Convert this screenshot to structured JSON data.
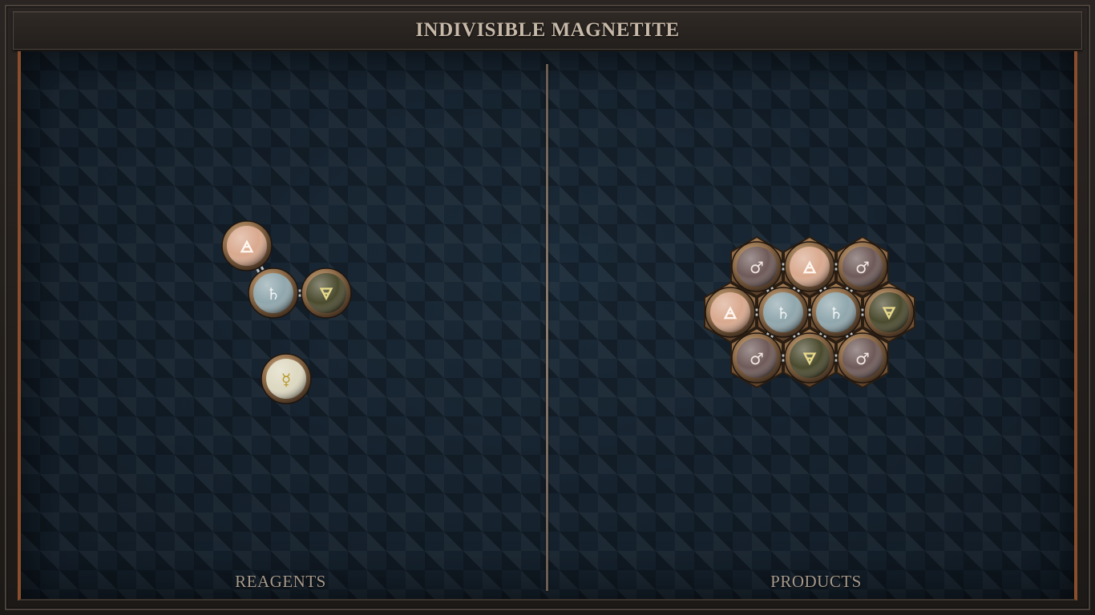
{
  "puzzle": {
    "title": "INDIVISIBLE MAGNETITE"
  },
  "panels": {
    "reagents_label": "REAGENTS",
    "products_label": "PRODUCTS"
  },
  "element_colors": {
    "air": "#d9a98e",
    "salt": "#8fa7ad",
    "earth": "#4a4a2e",
    "quicksilver": "#ddd8c0",
    "iron": "#6e5a58"
  },
  "element_glyphs": {
    "air": "🜁",
    "salt": "♄",
    "earth": "🜃",
    "quicksilver": "☿",
    "iron": "♂"
  },
  "reagents": [
    {
      "name": "reagent-1",
      "atoms": [
        "air",
        "salt",
        "earth"
      ],
      "bonds": [
        [
          0,
          1
        ],
        [
          1,
          2
        ]
      ]
    },
    {
      "name": "reagent-2",
      "atoms": [
        "quicksilver"
      ],
      "bonds": []
    }
  ],
  "products": [
    {
      "name": "product-magnetite",
      "atoms": [
        "iron",
        "air",
        "iron",
        "air",
        "salt",
        "salt",
        "earth",
        "iron",
        "earth",
        "iron"
      ],
      "bonds": [
        [
          0,
          1
        ],
        [
          1,
          2
        ],
        [
          0,
          4
        ],
        [
          1,
          4
        ],
        [
          1,
          5
        ],
        [
          2,
          5
        ],
        [
          3,
          4
        ],
        [
          4,
          5
        ],
        [
          5,
          6
        ],
        [
          4,
          7
        ],
        [
          4,
          8
        ],
        [
          5,
          8
        ],
        [
          5,
          9
        ],
        [
          7,
          8
        ],
        [
          8,
          9
        ]
      ]
    }
  ]
}
